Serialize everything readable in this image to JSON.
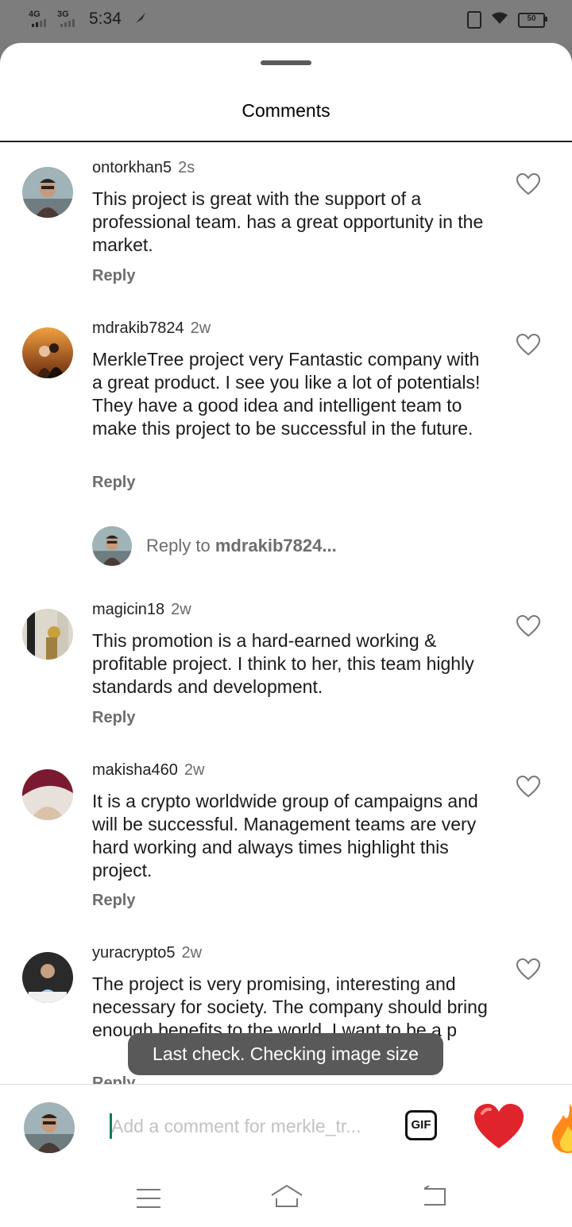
{
  "status_bar": {
    "network1": "4G",
    "network2": "3G",
    "time": "5:34",
    "battery": "50",
    "icons": [
      "signal-icon",
      "feather-icon",
      "vibrate-icon",
      "wifi-icon",
      "battery-icon"
    ]
  },
  "sheet": {
    "title": "Comments"
  },
  "comments": [
    {
      "username": "ontorkhan5",
      "time": "2s",
      "text": "This project is great with the support of a professional team. has a great opportunity in the market.",
      "reply_label": "Reply"
    },
    {
      "username": "mdrakib7824",
      "time": "2w",
      "text": "MerkleTree project very Fantastic company with a great product. I see you like a lot of potentials! They have a good idea and intelligent team to make this project to be successful in the future.",
      "reply_label": "Reply"
    },
    {
      "username": "magicin18",
      "time": "2w",
      "text": "This promotion is a hard-earned working & profitable project. I think to her,  this team highly standards and development.",
      "reply_label": "Reply"
    },
    {
      "username": "makisha460",
      "time": "2w",
      "text": "It is a crypto worldwide group of campaigns and will be successful. Management teams are very hard working and always times highlight this project.",
      "reply_label": "Reply"
    },
    {
      "username": "yuracrypto5",
      "time": "2w",
      "text": "The project is very promising, interesting and necessary for society. The company should bring enough benefits to the world. I want to be a p",
      "reply_label": "Reply"
    }
  ],
  "reply_to": {
    "prefix": "Reply to",
    "username": "mdrakib7824..."
  },
  "toast": "Last check. Checking image size",
  "composer": {
    "placeholder": "Add a comment for merkle_tr...",
    "gif_label": "GIF"
  },
  "colors": {
    "status_bar": "#7d7d7d",
    "heart_emoji": "#e0242c",
    "toast_bg": "#595959",
    "cursor": "#0a7a5a"
  }
}
